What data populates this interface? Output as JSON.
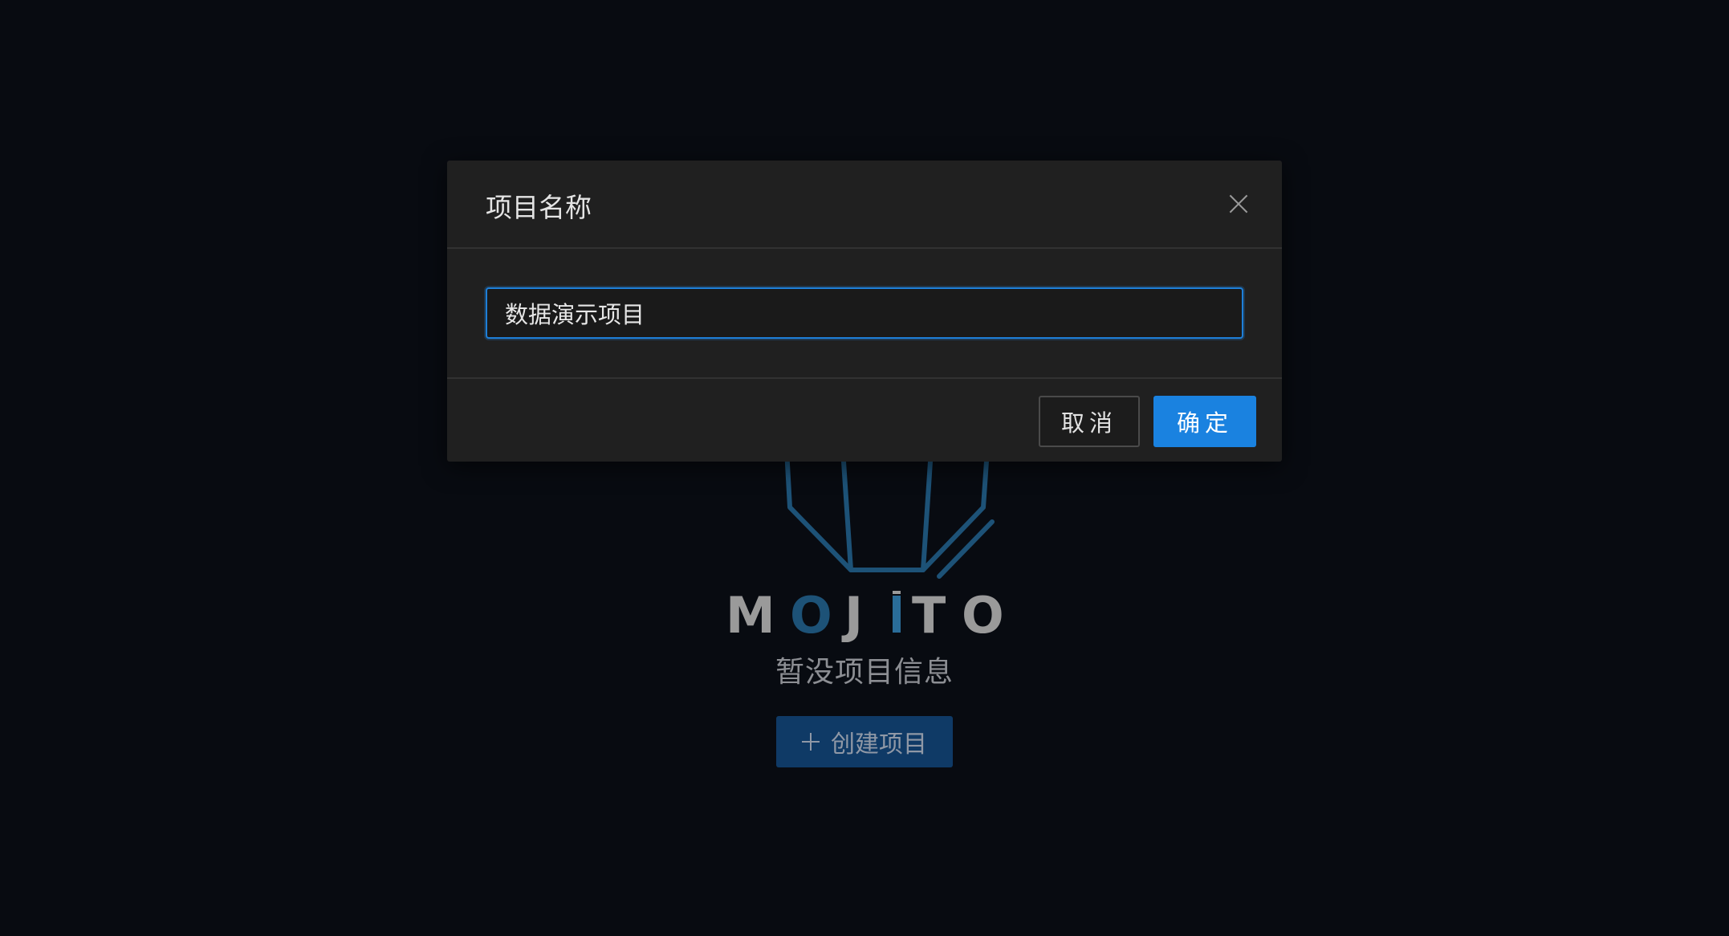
{
  "empty_state": {
    "logo_text": "MOJITO",
    "message": "暂没项目信息",
    "create_label": "创建项目"
  },
  "modal": {
    "title": "项目名称",
    "input_value": "数据演示项目",
    "cancel_label": "取消",
    "confirm_label": "确定"
  },
  "colors": {
    "background": "#080b11",
    "modal_bg": "#202020",
    "accent": "#1a82e0",
    "logo_blue": "#1d5277",
    "logo_gray": "#9a9a9a"
  }
}
